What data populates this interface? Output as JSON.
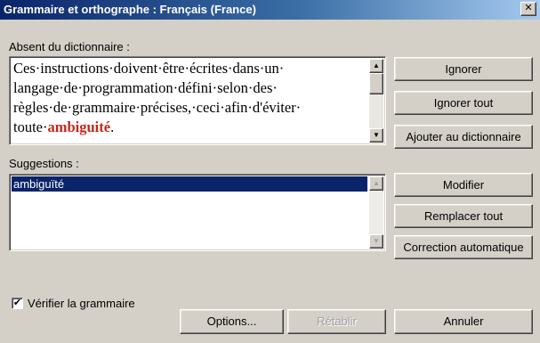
{
  "window": {
    "title": "Grammaire et orthographe : Français (France)",
    "close_glyph": "✕"
  },
  "not_in_dictionary": {
    "label": "Absent du dictionnaire :",
    "text_before": "Ces·instructions·doivent·être·écrites·dans·un· langage·de·programmation·défini·selon·des· règles·de·grammaire·précises,·ceci·afin·d'éviter· toute·",
    "error_word": "ambiguité",
    "text_after": "."
  },
  "suggestions": {
    "label": "Suggestions :",
    "items": [
      "ambiguïté"
    ]
  },
  "buttons": {
    "ignore": "Ignorer",
    "ignore_all": "Ignorer tout",
    "add_to_dictionary": "Ajouter au dictionnaire",
    "change": "Modifier",
    "change_all": "Remplacer tout",
    "autocorrect": "Correction automatique",
    "options": "Options...",
    "undo": "Rétablir",
    "cancel": "Annuler"
  },
  "check_grammar": {
    "label": "Vérifier la grammaire",
    "checked": true,
    "check_glyph": "✔"
  },
  "icons": {
    "scroll_up": "▲",
    "scroll_down": "▼"
  },
  "colors": {
    "title_start": "#0a246a",
    "selection": "#0a246a",
    "error_word": "#c0281e",
    "dialog_bg": "#d4d0c8"
  }
}
